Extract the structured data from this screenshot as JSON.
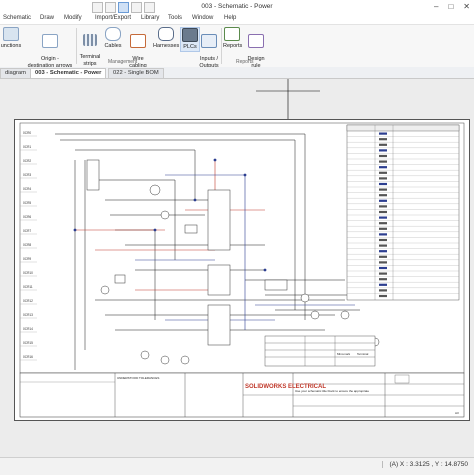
{
  "window": {
    "title": "003 - Schematic - Power"
  },
  "menu": [
    "Schematic",
    "Draw",
    "Modify",
    "Import/Export",
    "Library",
    "Tools",
    "Window",
    "Help"
  ],
  "ribbon": {
    "buttons": [
      {
        "label": "unctions",
        "icon": "functions-icon"
      },
      {
        "label": "Origin -\ndestination arrows",
        "icon": "origin-destination-icon"
      },
      {
        "label": "Terminal\nstrips",
        "icon": "terminal-strips-icon"
      },
      {
        "label": "Cables",
        "icon": "cables-icon"
      },
      {
        "label": "Wire cabling\norder",
        "icon": "wire-cabling-icon"
      },
      {
        "label": "Harnesses",
        "icon": "harnesses-icon"
      },
      {
        "label": "PLCs",
        "icon": "plc-icon"
      },
      {
        "label": "Inputs /\nOutputs",
        "icon": "inputs-outputs-icon"
      },
      {
        "label": "Reports",
        "icon": "reports-icon"
      },
      {
        "label": "Design\nrule check",
        "icon": "design-rule-check-icon"
      }
    ],
    "groups": [
      "Management",
      "Reports"
    ]
  },
  "tabs": [
    {
      "label": "diagram",
      "active": false
    },
    {
      "label": "003 - Schematic - Power",
      "active": true
    },
    {
      "label": "022 - Single BOM",
      "active": false
    }
  ],
  "drawing": {
    "row_labels": [
      "0CR0",
      "0CR1",
      "0CR2",
      "0CR3",
      "0CR4",
      "0CR5",
      "0CR6",
      "0CR7",
      "0CR8",
      "0CR9",
      "0CR10",
      "0CR11",
      "0CR12",
      "0CR13",
      "0CR14",
      "0CR15",
      "0CR16"
    ],
    "company": "SOLIDWORKS ELECTRICAL",
    "title_block_note": "Use your schematic title block to ensure the appropriate",
    "tolerances_header": "UNDERSTOOD TOLERANCES",
    "legend_columns": [
      "Mini-mark",
      "Terminal"
    ],
    "size": "A3",
    "colors": {
      "wire_red": "#c0392b",
      "wire_blue": "#2c3e90",
      "wire_black": "#1a1a1a"
    }
  },
  "status": {
    "coords": "(A) X : 3.3125 , Y : 14.8750"
  }
}
